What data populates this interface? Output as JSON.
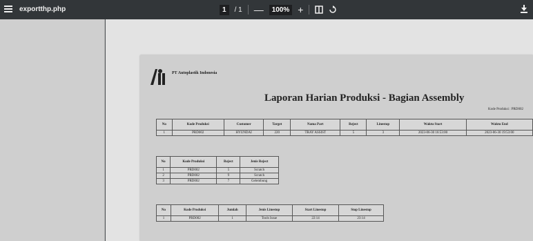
{
  "toolbar": {
    "title": "exportthp.php",
    "page_current": "1",
    "page_total": "/ 1",
    "zoom_minus": "—",
    "zoom": "100%",
    "zoom_plus": "+",
    "fit_icon": "fit-page-icon",
    "rotate_icon": "rotate-icon",
    "download_icon": "download-icon"
  },
  "report": {
    "company": "PT Autoplastik Indonesia",
    "title": "Laporan Harian Produksi - Bagian Assembly",
    "kode_label": "Kode Produksi : PRD002",
    "table1": {
      "headers": [
        "No",
        "Kode Produksi",
        "Customer",
        "Target",
        "Nama Part",
        "Reject",
        "Linestop",
        "Waktu Start",
        "Waktu End"
      ],
      "rows": [
        [
          "1",
          "PRD002",
          "HYUNDAI",
          "220",
          "TRAY ASSIST",
          "5",
          "3",
          "2023-06-30 16:53:00",
          "2023-06-30 19:53:00"
        ]
      ]
    },
    "table2": {
      "headers": [
        "No",
        "Kode Produksi",
        "Reject",
        "Jenis Reject"
      ],
      "rows": [
        [
          "1",
          "PRD002",
          "5",
          "Scratch"
        ],
        [
          "2",
          "PRD002",
          "9",
          "Scratch"
        ],
        [
          "3",
          "PRD002",
          "7",
          "Gelembung"
        ]
      ]
    },
    "table3": {
      "headers": [
        "No",
        "Kode Produksi",
        "Jumlah",
        "Jenis Linestop",
        "Start Linestop",
        "Stop Linestop"
      ],
      "rows": [
        [
          "1",
          "PRD002",
          "1",
          "Tools Issue",
          "22:14",
          "23:14"
        ]
      ]
    }
  }
}
